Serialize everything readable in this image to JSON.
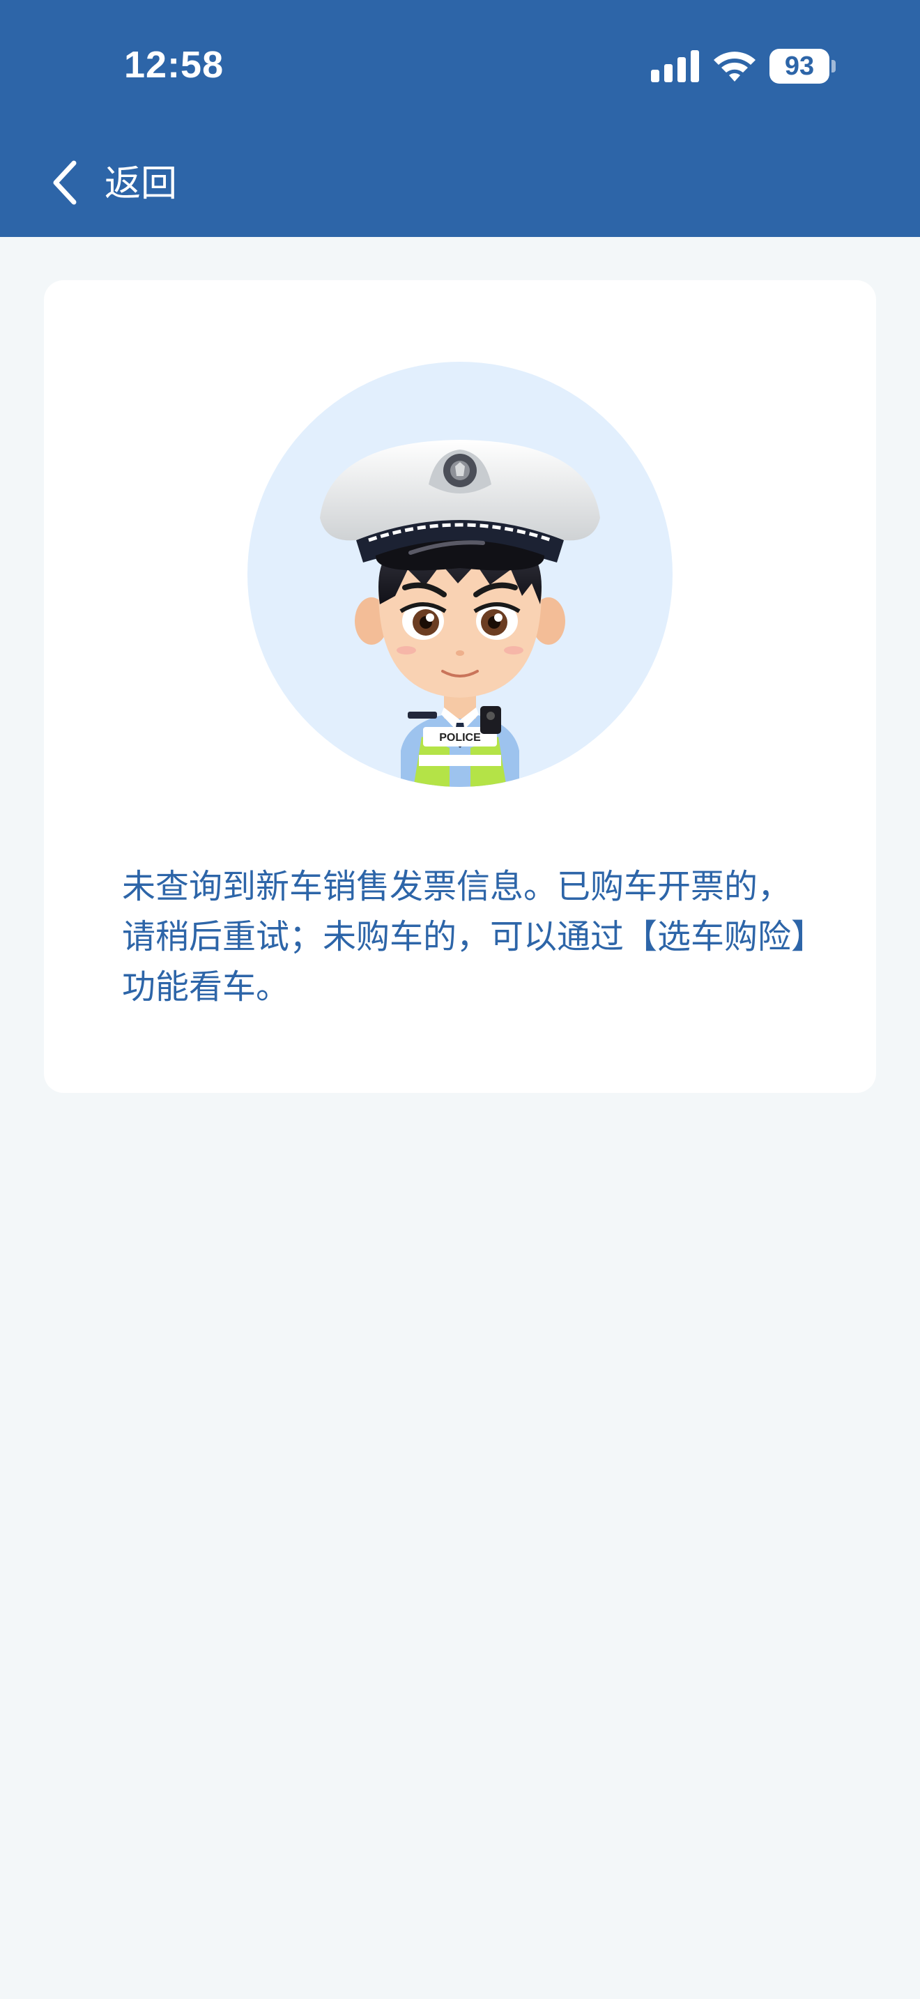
{
  "status_bar": {
    "time": "12:58",
    "battery_level": "93",
    "icons": [
      "cellular-signal-icon",
      "wifi-icon",
      "battery-icon"
    ]
  },
  "nav": {
    "back_label": "返回",
    "back_icon": "chevron-left-icon"
  },
  "card": {
    "illustration": "police-officer-avatar",
    "illustration_badge_text": "POLICE",
    "message": "未查询到新车销售发票信息。已购车开票的，请稍后重试；未购车的，可以通过【选车购险】功能看车。"
  },
  "colors": {
    "header": "#2d65a8",
    "background": "#f3f7f9",
    "card": "#ffffff",
    "text": "#2d65a8",
    "avatar_circle": "#e2effd"
  }
}
